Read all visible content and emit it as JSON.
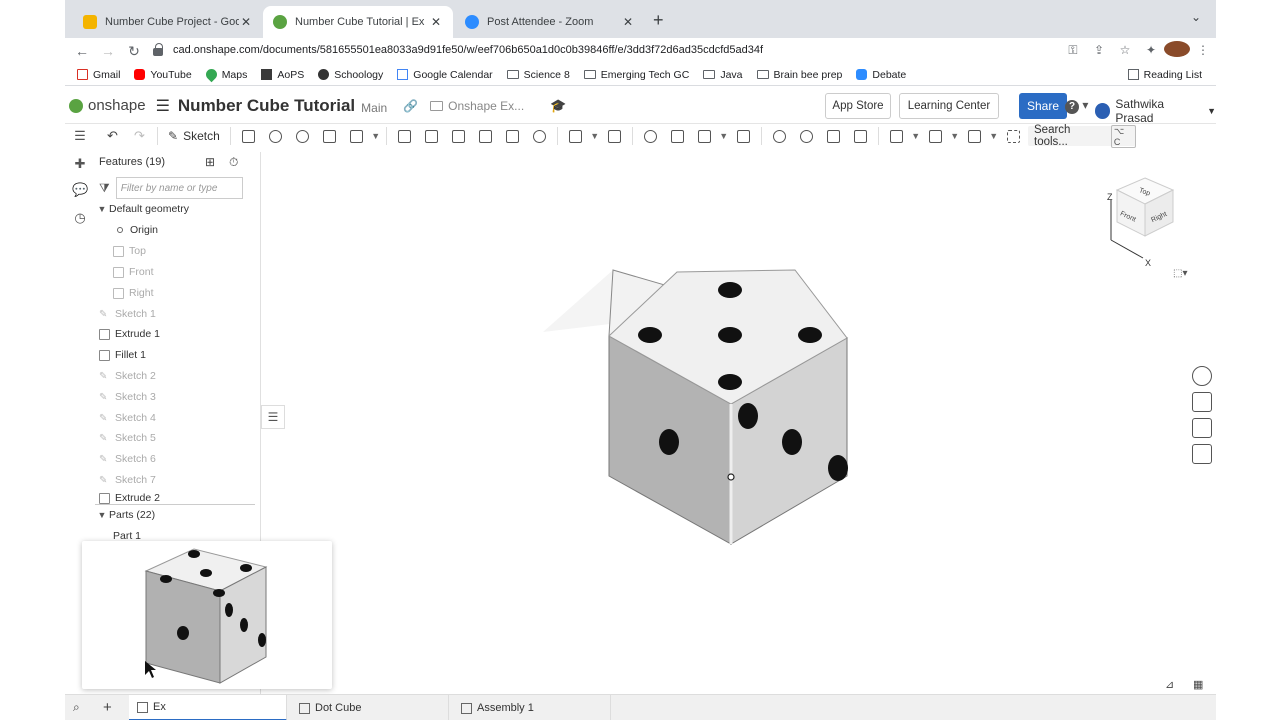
{
  "browser": {
    "tabs": [
      {
        "title": "Number Cube Project - Google",
        "favicon_color": "#f4b400",
        "active": false
      },
      {
        "title": "Number Cube Tutorial | Ex",
        "favicon_color": "#5aa342",
        "active": true
      },
      {
        "title": "Post Attendee - Zoom",
        "favicon_color": "#2d8cff",
        "active": false
      }
    ],
    "url": "cad.onshape.com/documents/581655501ea8033a9d91fe50/w/eef706b650a1d0c0b39846ff/e/3dd3f72d6ad35cdcfd5ad34f",
    "bookmarks": [
      {
        "label": "Gmail",
        "icon": "gmail-icon"
      },
      {
        "label": "YouTube",
        "icon": "youtube-icon"
      },
      {
        "label": "Maps",
        "icon": "maps-icon"
      },
      {
        "label": "AoPS",
        "icon": "aops-icon"
      },
      {
        "label": "Schoology",
        "icon": "schoology-icon"
      },
      {
        "label": "Google Calendar",
        "icon": "calendar-icon"
      },
      {
        "label": "Science 8",
        "icon": "folder-icon"
      },
      {
        "label": "Emerging Tech GC",
        "icon": "folder-icon"
      },
      {
        "label": "Java",
        "icon": "folder-icon"
      },
      {
        "label": "Brain bee prep",
        "icon": "folder-icon"
      },
      {
        "label": "Debate",
        "icon": "zoom-icon"
      }
    ],
    "reading_list": "Reading List"
  },
  "header": {
    "logo": "onshape",
    "doc_title": "Number Cube Tutorial",
    "branch": "Main",
    "folder": "Onshape Ex...",
    "app_store": "App Store",
    "learning_center": "Learning Center",
    "share": "Share",
    "help": "?",
    "user": "Sathwika Prasad"
  },
  "toolbar": {
    "sketch": "Sketch",
    "search_tools": "Search tools...",
    "search_shortcut": "⌥ C"
  },
  "features": {
    "title": "Features (19)",
    "filter_placeholder": "Filter by name or type",
    "default_geometry": "Default geometry",
    "items": [
      {
        "label": "Origin",
        "kind": "origin",
        "dim": false
      },
      {
        "label": "Top",
        "kind": "plane",
        "dim": true
      },
      {
        "label": "Front",
        "kind": "plane",
        "dim": true
      },
      {
        "label": "Right",
        "kind": "plane",
        "dim": true
      }
    ],
    "list": [
      {
        "label": "Sketch 1",
        "kind": "sketch",
        "dim": true
      },
      {
        "label": "Extrude 1",
        "kind": "extrude",
        "dim": false
      },
      {
        "label": "Fillet 1",
        "kind": "fillet",
        "dim": false
      },
      {
        "label": "Sketch 2",
        "kind": "sketch",
        "dim": true
      },
      {
        "label": "Sketch 3",
        "kind": "sketch",
        "dim": true
      },
      {
        "label": "Sketch 4",
        "kind": "sketch",
        "dim": true
      },
      {
        "label": "Sketch 5",
        "kind": "sketch",
        "dim": true
      },
      {
        "label": "Sketch 6",
        "kind": "sketch",
        "dim": true
      },
      {
        "label": "Sketch 7",
        "kind": "sketch",
        "dim": true
      },
      {
        "label": "Extrude 2",
        "kind": "extrude",
        "dim": false
      }
    ],
    "parts_title": "Parts (22)",
    "parts": [
      "Part 1"
    ]
  },
  "viewcube": {
    "top": "Top",
    "front": "Front",
    "right": "Right",
    "z": "Z",
    "x": "X"
  },
  "bottom_tabs": [
    {
      "label": "Ex",
      "active": true
    },
    {
      "label": "Dot Cube",
      "active": false
    },
    {
      "label": "Assembly 1",
      "active": false
    }
  ]
}
